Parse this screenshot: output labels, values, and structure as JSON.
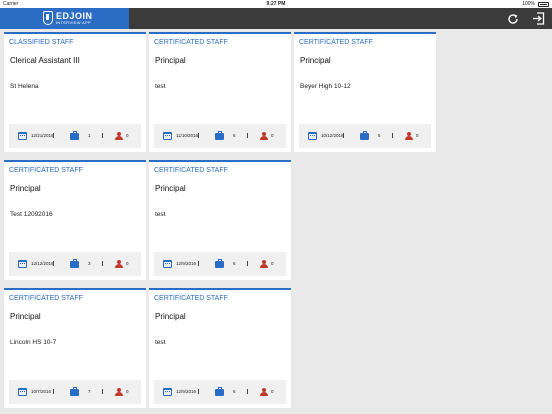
{
  "status_bar": {
    "carrier": "Carrier",
    "time": "9:27 PM",
    "battery": "100%"
  },
  "app": {
    "logo_title": "EDJOIN",
    "logo_subtitle": "INTERVIEW APP"
  },
  "icons": {
    "refresh": "refresh-icon",
    "logout": "logout-icon",
    "calendar": "calendar-icon",
    "briefcase": "briefcase-icon",
    "person": "person-icon"
  },
  "colors": {
    "accent": "#2b6cc4",
    "appbar": "#3b3b3b",
    "person": "#c0392b"
  },
  "cards": [
    {
      "category": "CLASSIFIED STAFF",
      "title": "Clerical Assistant III",
      "subtitle": "St Helena",
      "date": "12/21/2016",
      "count": "1",
      "candidates": "0"
    },
    {
      "category": "CERTIFICATED STAFF",
      "title": "Principal",
      "subtitle": "test",
      "date": "11/10/2016",
      "count": "6",
      "candidates": "0"
    },
    {
      "category": "CERTIFICATED STAFF",
      "title": "Principal",
      "subtitle": "Beyer High 10-12",
      "date": "10/12/2016",
      "count": "5",
      "candidates": "0"
    },
    {
      "category": "CERTIFICATED STAFF",
      "title": "Principal",
      "subtitle": "Test 12092016",
      "date": "12/12/2016",
      "count": "3",
      "candidates": "0"
    },
    {
      "category": "CERTIFICATED STAFF",
      "title": "Principal",
      "subtitle": "test",
      "date": "12/9/2016",
      "count": "6",
      "candidates": "0"
    },
    {
      "category": "CERTIFICATED STAFF",
      "title": "Principal",
      "subtitle": "Lincoln HS 10-7",
      "date": "10/7/2016",
      "count": "7",
      "candidates": "0"
    },
    {
      "category": "CERTIFICATED STAFF",
      "title": "Principal",
      "subtitle": "test",
      "date": "12/9/2016",
      "count": "6",
      "candidates": "0"
    }
  ]
}
